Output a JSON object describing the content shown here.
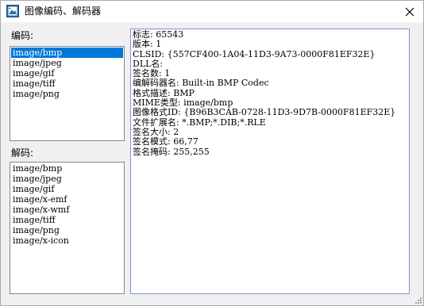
{
  "window": {
    "title": "图像编码、解码器",
    "icon": "app-image-codec-icon",
    "close_icon": "close-icon",
    "accent": "#0078d7"
  },
  "encoders": {
    "label": "编码:",
    "items": [
      "image/bmp",
      "image/jpeg",
      "image/gif",
      "image/tiff",
      "image/png"
    ],
    "selected_index": 0
  },
  "decoders": {
    "label": "解码:",
    "items": [
      "image/bmp",
      "image/jpeg",
      "image/gif",
      "image/x-emf",
      "image/x-wmf",
      "image/tiff",
      "image/png",
      "image/x-icon"
    ]
  },
  "details": {
    "lines": [
      "标志: 65543",
      "版本: 1",
      "CLSID: {557CF400-1A04-11D3-9A73-0000F81EF32E}",
      "DLL名:",
      "签名数: 1",
      "编解码器名: Built-in BMP Codec",
      "格式描述: BMP",
      "MIME类型: image/bmp",
      "图像格式ID: {B96B3CAB-0728-11D3-9D7B-0000F81EF32E}",
      "文件扩展名: *.BMP;*.DIB;*.RLE",
      "签名大小: 2",
      "签名模式: 66,77",
      "签名掩码: 255,255"
    ]
  }
}
